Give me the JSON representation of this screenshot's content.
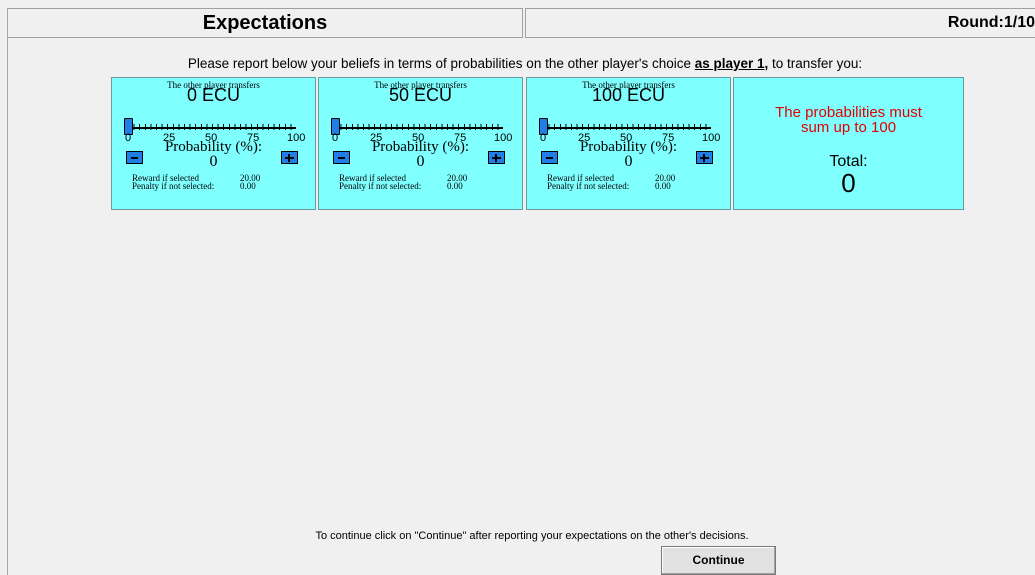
{
  "header": {
    "title": "Expectations",
    "round": "Round:1/10"
  },
  "instruction": {
    "before": "Please report below your beliefs in terms of probabilities on the other player's choice ",
    "emphasis": "as player 1,",
    "after": " to transfer you:"
  },
  "panels": [
    {
      "transfers_label": "The other player transfers",
      "amount": "0 ECU",
      "ticks": [
        "0",
        "25",
        "50",
        "75",
        "100"
      ],
      "probability_label": "Probability (%):",
      "probability_value": "0",
      "slider_value": 0,
      "reward_label": "Reward if selected",
      "reward_value": "20.00",
      "penalty_label": "Penalty if not selected:",
      "penalty_value": "0.00"
    },
    {
      "transfers_label": "The other player transfers",
      "amount": "50 ECU",
      "ticks": [
        "0",
        "25",
        "50",
        "75",
        "100"
      ],
      "probability_label": "Probability (%):",
      "probability_value": "0",
      "slider_value": 0,
      "reward_label": "Reward if selected",
      "reward_value": "20.00",
      "penalty_label": "Penalty if not selected:",
      "penalty_value": "0.00"
    },
    {
      "transfers_label": "The other player transfers",
      "amount": "100 ECU",
      "ticks": [
        "0",
        "25",
        "50",
        "75",
        "100"
      ],
      "probability_label": "Probability (%):",
      "probability_value": "0",
      "slider_value": 0,
      "reward_label": "Reward if selected",
      "reward_value": "20.00",
      "penalty_label": "Penalty if not selected:",
      "penalty_value": "0.00"
    }
  ],
  "total_panel": {
    "warning_line1": "The probabilities must",
    "warning_line2": "sum up to 100",
    "total_label": "Total:",
    "total_value": "0"
  },
  "footer": {
    "text": "To continue click on \"Continue\" after reporting your expectations on the other's decisions.",
    "continue_label": "Continue"
  },
  "colors": {
    "panel_bg": "#80ffff",
    "accent": "#1f7fe6",
    "warning": "#e00000",
    "page_bg": "#f0f0f0"
  },
  "icons": [
    "minus-icon",
    "plus-icon"
  ]
}
